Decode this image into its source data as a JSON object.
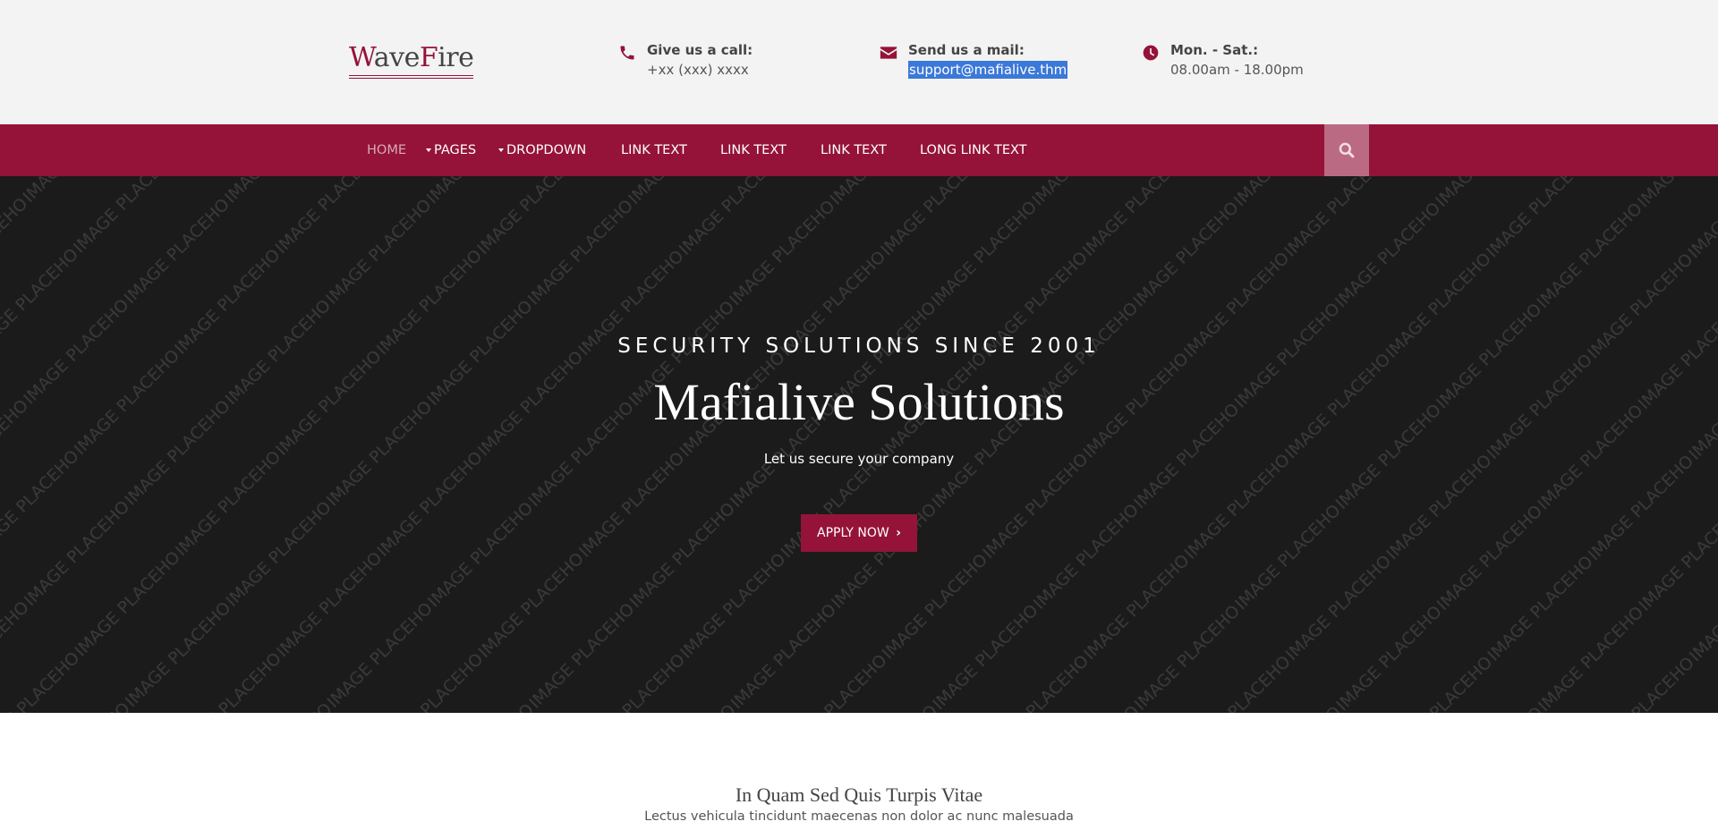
{
  "brand": {
    "logo_first_letter": "W",
    "logo_part1": "ave",
    "logo_second_letter": "F",
    "logo_part2": "ire",
    "accent_color": "#951339"
  },
  "header": {
    "call": {
      "icon": "phone-icon",
      "title": "Give us a call:",
      "value": "+xx (xxx) xxxx"
    },
    "mail": {
      "icon": "envelope-icon",
      "title": "Send us a mail:",
      "value": "support@mafialive.thm"
    },
    "hours": {
      "icon": "clock-icon",
      "title": "Mon. - Sat.:",
      "value": "08.00am - 18.00pm"
    }
  },
  "nav": {
    "items": [
      {
        "label": "HOME"
      },
      {
        "label": "PAGES"
      },
      {
        "label": "DROPDOWN"
      },
      {
        "label": "LINK TEXT"
      },
      {
        "label": "LINK TEXT"
      },
      {
        "label": "LINK TEXT"
      },
      {
        "label": "LONG LINK TEXT"
      }
    ],
    "search_icon": "search-icon"
  },
  "hero": {
    "placeholder_text": "IMAGE PLACEHOLDER",
    "eyebrow": "SECURITY SOLUTIONS SINCE 2001",
    "title": "Mafialive Solutions",
    "subtitle": "Let us secure your company",
    "cta_label": "APPLY NOW"
  },
  "section": {
    "title": "In Quam Sed Quis Turpis Vitae",
    "subtitle": "Lectus vehicula tincidunt maecenas non dolor ac nunc malesuada"
  }
}
